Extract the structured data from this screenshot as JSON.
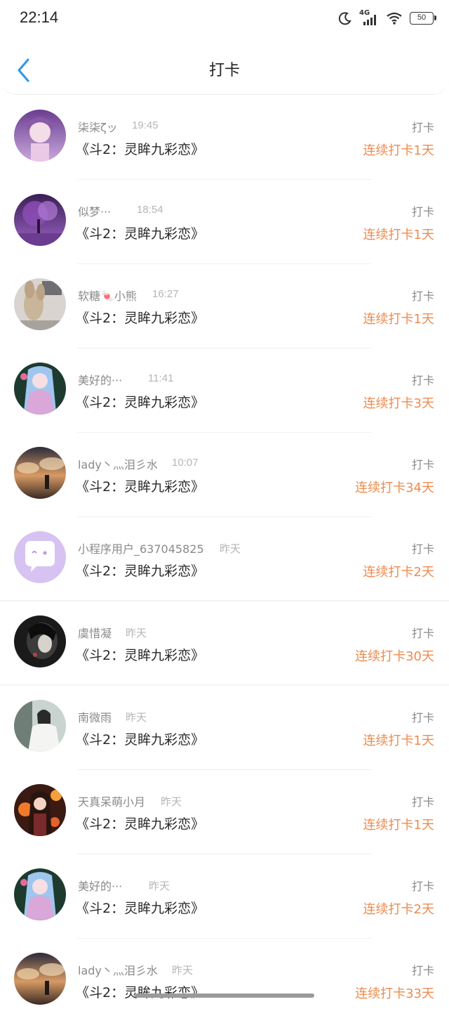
{
  "status_bar": {
    "time": "22:14",
    "network": "4G",
    "battery": "50"
  },
  "header": {
    "title": "打卡",
    "back_icon": "chevron-left-icon"
  },
  "colors": {
    "accent": "#2e9ae6",
    "streak": "#ef8a4d",
    "muted_text": "#8a8a8a"
  },
  "records": [
    {
      "name": "柒柒ζッ",
      "time": "19:45",
      "book": "《斗2：灵眸九彩恋》",
      "action": "打卡",
      "streak": "连续打卡1天"
    },
    {
      "name": "似梦···",
      "time": "18:54",
      "book": "《斗2：灵眸九彩恋》",
      "action": "打卡",
      "streak": "连续打卡1天"
    },
    {
      "name": "软糖🍬小熊",
      "time": "16:27",
      "book": "《斗2：灵眸九彩恋》",
      "action": "打卡",
      "streak": "连续打卡1天"
    },
    {
      "name": "美好的···",
      "time": "11:41",
      "book": "《斗2：灵眸九彩恋》",
      "action": "打卡",
      "streak": "连续打卡3天"
    },
    {
      "name": "lady丶灬泪彡水",
      "time": "10:07",
      "book": "《斗2：灵眸九彩恋》",
      "action": "打卡",
      "streak": "连续打卡34天"
    },
    {
      "name": "小程序用户_637045825",
      "time": "昨天",
      "book": "《斗2：灵眸九彩恋》",
      "action": "打卡",
      "streak": "连续打卡2天"
    },
    {
      "name": "虞惜凝",
      "time": "昨天",
      "book": "《斗2：灵眸九彩恋》",
      "action": "打卡",
      "streak": "连续打卡30天"
    },
    {
      "name": "南微雨",
      "time": "昨天",
      "book": "《斗2：灵眸九彩恋》",
      "action": "打卡",
      "streak": "连续打卡1天"
    },
    {
      "name": "天真呆萌小月",
      "time": "昨天",
      "book": "《斗2：灵眸九彩恋》",
      "action": "打卡",
      "streak": "连续打卡1天"
    },
    {
      "name": "美好的···",
      "time": "昨天",
      "book": "《斗2：灵眸九彩恋》",
      "action": "打卡",
      "streak": "连续打卡2天"
    },
    {
      "name": "lady丶灬泪彡水",
      "time": "昨天",
      "book": "《斗2：灵眸九彩恋》",
      "action": "打卡",
      "streak": "连续打卡33天"
    }
  ]
}
